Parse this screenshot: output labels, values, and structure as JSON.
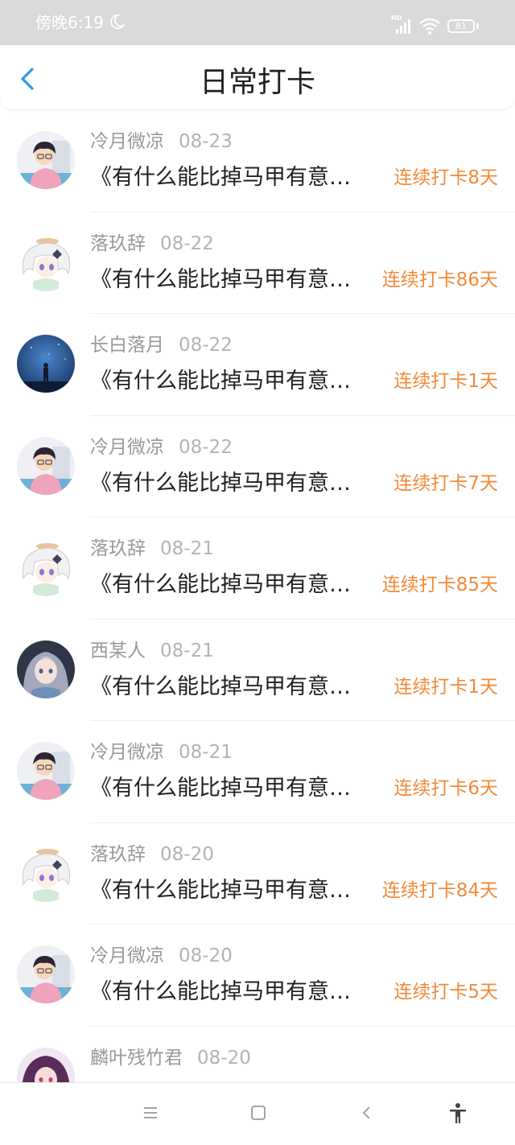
{
  "status_bar": {
    "time": "傍晚6:19",
    "battery": "81",
    "network": "HD",
    "icons": [
      "moon-icon",
      "signal-icon",
      "wifi-icon",
      "battery-icon"
    ]
  },
  "header": {
    "title": "日常打卡",
    "back_icon": "chevron-left-icon",
    "accent_color": "#2b9be8"
  },
  "entries": [
    {
      "name": "冷月微凉",
      "date": "08-23",
      "title": "《有什么能比掉马甲有意…",
      "streak": "连续打卡8天",
      "avatar": "boy-cartoon-avatar"
    },
    {
      "name": "落玖辞",
      "date": "08-22",
      "title": "《有什么能比掉马甲有意…",
      "streak": "连续打卡86天",
      "avatar": "white-hair-anime-avatar"
    },
    {
      "name": "长白落月",
      "date": "08-22",
      "title": "《有什么能比掉马甲有意…",
      "streak": "连续打卡1天",
      "avatar": "night-sky-avatar"
    },
    {
      "name": "冷月微凉",
      "date": "08-22",
      "title": "《有什么能比掉马甲有意…",
      "streak": "连续打卡7天",
      "avatar": "boy-cartoon-avatar"
    },
    {
      "name": "落玖辞",
      "date": "08-21",
      "title": "《有什么能比掉马甲有意…",
      "streak": "连续打卡85天",
      "avatar": "white-hair-anime-avatar"
    },
    {
      "name": "西某人",
      "date": "08-21",
      "title": "《有什么能比掉马甲有意…",
      "streak": "连续打卡1天",
      "avatar": "silver-hair-anime-avatar"
    },
    {
      "name": "冷月微凉",
      "date": "08-21",
      "title": "《有什么能比掉马甲有意…",
      "streak": "连续打卡6天",
      "avatar": "boy-cartoon-avatar"
    },
    {
      "name": "落玖辞",
      "date": "08-20",
      "title": "《有什么能比掉马甲有意…",
      "streak": "连续打卡84天",
      "avatar": "white-hair-anime-avatar"
    },
    {
      "name": "冷月微凉",
      "date": "08-20",
      "title": "《有什么能比掉马甲有意…",
      "streak": "连续打卡5天",
      "avatar": "boy-cartoon-avatar"
    },
    {
      "name": "麟叶残竹君",
      "date": "08-20",
      "title": "",
      "streak": "",
      "avatar": "purple-hair-anime-avatar"
    }
  ],
  "colors": {
    "streak": "#f08a3a",
    "name": "#999999",
    "title": "#222222"
  },
  "nav_bar": {
    "icons": [
      "menu-icon",
      "home-square-icon",
      "back-triangle-icon",
      "accessibility-icon"
    ]
  }
}
